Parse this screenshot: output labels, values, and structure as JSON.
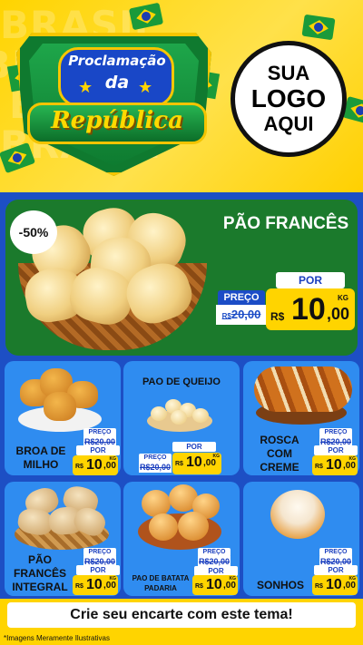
{
  "header": {
    "watermark": "BRASIL",
    "title_line1": "Proclamação",
    "title_line2": "da",
    "title_line3": "República",
    "logo_line1": "SUA",
    "logo_line2": "LOGO",
    "logo_line3": "AQUI"
  },
  "featured": {
    "discount": "-50%",
    "name": "PÃO FRANCÊS",
    "preco_label": "PREÇO",
    "old_currency": "R$",
    "old_price": "20,00",
    "por_label": "POR",
    "currency": "R$",
    "price_int": "10",
    "price_dec": ",00",
    "unit": "KG"
  },
  "products": [
    {
      "name": "BROA DE MILHO",
      "preco_label": "PREÇO",
      "old_price": "R$20,00",
      "por_label": "POR",
      "currency": "R$",
      "price_int": "10",
      "price_dec": ",00",
      "unit": "KG"
    },
    {
      "name": "PAO DE QUEIJO",
      "preco_label": "PREÇO",
      "old_price": "R$20,00",
      "por_label": "POR",
      "currency": "R$",
      "price_int": "10",
      "price_dec": ",00",
      "unit": "KG"
    },
    {
      "name": "ROSCA COM CREME",
      "preco_label": "PREÇO",
      "old_price": "R$20,00",
      "por_label": "POR",
      "currency": "R$",
      "price_int": "10",
      "price_dec": ",00",
      "unit": "KG"
    },
    {
      "name": "PÃO FRANCÊS INTEGRAL",
      "preco_label": "PREÇO",
      "old_price": "R$20,00",
      "por_label": "POR",
      "currency": "R$",
      "price_int": "10",
      "price_dec": ",00",
      "unit": "KG"
    },
    {
      "name": "PAO DE BATATA PADARIA",
      "preco_label": "PREÇO",
      "old_price": "R$20,00",
      "por_label": "POR",
      "currency": "R$",
      "price_int": "10",
      "price_dec": ",00",
      "unit": "KG"
    },
    {
      "name": "SONHOS",
      "preco_label": "PREÇO",
      "old_price": "R$20,00",
      "por_label": "POR",
      "currency": "R$",
      "price_int": "10",
      "price_dec": ",00",
      "unit": "KG"
    }
  ],
  "cta": "Crie seu encarte com este tema!",
  "footer": "*Imagens Meramente Ilustrativas",
  "colors": {
    "brand_green": "#1b7a2c",
    "brand_blue": "#1d4fc4",
    "card_blue": "#2f8cf0",
    "yellow": "#ffd400"
  }
}
